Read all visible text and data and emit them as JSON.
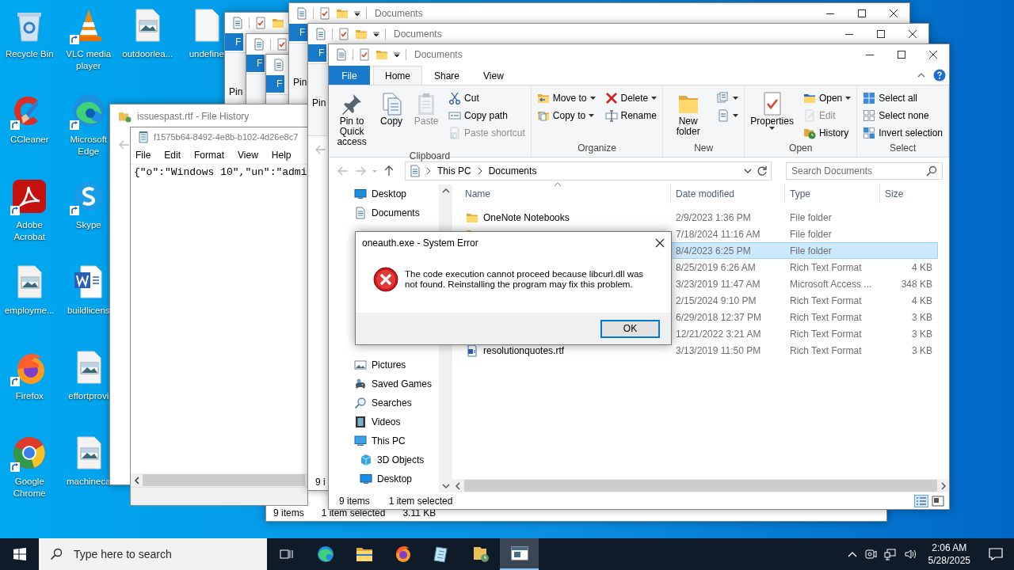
{
  "desktop": {
    "columns": [
      {
        "icons": [
          {
            "label": "Recycle Bin",
            "shortcut": false
          },
          {
            "label": "CCleaner",
            "shortcut": true
          },
          {
            "label": "Adobe Acrobat",
            "shortcut": true
          },
          {
            "label": "employme...",
            "shortcut": false
          },
          {
            "label": "Firefox",
            "shortcut": true
          },
          {
            "label": "Google Chrome",
            "shortcut": true
          }
        ]
      },
      {
        "icons": [
          {
            "label": "VLC media player",
            "shortcut": true
          },
          {
            "label": "Microsoft Edge",
            "shortcut": true
          },
          {
            "label": "Skype",
            "shortcut": true
          },
          {
            "label": "buildlicens",
            "shortcut": false
          },
          {
            "label": "effortprovi",
            "shortcut": false
          },
          {
            "label": "machineca",
            "shortcut": false
          }
        ]
      },
      {
        "icons": [
          {
            "label": "outdoorlea...",
            "shortcut": false
          }
        ]
      },
      {
        "icons": [
          {
            "label": "undefine",
            "shortcut": false
          }
        ]
      }
    ]
  },
  "back_windows": [
    {
      "file_tab": "F",
      "ribbon_text": "Pin"
    },
    {
      "file_tab": "F"
    },
    {
      "file_tab": "F",
      "status": [
        "9 items",
        "1 item selected",
        "3.11 KB"
      ]
    },
    {
      "title": "Documents",
      "file_tab": "F",
      "ribbon_text": "Pin"
    },
    {
      "title": "Documents",
      "file_tab": "F",
      "ribbon_text": "Pin",
      "status": [
        "9 i"
      ]
    }
  ],
  "file_history": {
    "title": "issuespast.rtf - File History",
    "preview": {
      "file_name": "f1575b64-8492-4e8b-b102-4d26e8c7",
      "menu": [
        "File",
        "Edit",
        "Format",
        "View",
        "Help"
      ],
      "content": "{\"o\":\"Windows 10\",\"un\":\"admi"
    }
  },
  "explorer": {
    "title": "Documents",
    "ribbon_tabs": [
      {
        "label": "File",
        "kind": "file",
        "selected": false
      },
      {
        "label": "Home",
        "kind": "tab",
        "selected": true
      },
      {
        "label": "Share",
        "kind": "tab",
        "selected": false
      },
      {
        "label": "View",
        "kind": "tab",
        "selected": false
      }
    ],
    "ribbon": [
      {
        "label": "Clipboard",
        "items": [
          {
            "kind": "large",
            "label": "Pin to Quick access",
            "dropdown": false,
            "disabled": false
          },
          {
            "kind": "large",
            "label": "Copy",
            "dropdown": false,
            "disabled": false
          },
          {
            "kind": "large",
            "label": "Paste",
            "dropdown": false,
            "disabled": true
          },
          {
            "kind": "stack",
            "items": [
              {
                "label": "Cut",
                "dropdown": false,
                "disabled": false
              },
              {
                "label": "Copy path",
                "dropdown": false,
                "disabled": false
              },
              {
                "label": "Paste shortcut",
                "dropdown": false,
                "disabled": true
              }
            ]
          }
        ]
      },
      {
        "label": "Organize",
        "items": [
          {
            "kind": "stack",
            "items": [
              {
                "label": "Move to",
                "dropdown": true,
                "disabled": false
              },
              {
                "label": "Copy to",
                "dropdown": true,
                "disabled": false
              }
            ]
          },
          {
            "kind": "stack",
            "items": [
              {
                "label": "Delete",
                "dropdown": true,
                "disabled": false
              },
              {
                "label": "Rename",
                "dropdown": false,
                "disabled": false
              }
            ]
          }
        ]
      },
      {
        "label": "New",
        "items": [
          {
            "kind": "large",
            "label": "New folder",
            "dropdown": false,
            "disabled": false
          },
          {
            "kind": "stack",
            "items": [
              {
                "dropdown": true,
                "disabled": false
              },
              {
                "dropdown": true,
                "disabled": false
              }
            ]
          }
        ]
      },
      {
        "label": "Open",
        "items": [
          {
            "kind": "large",
            "label": "Properties",
            "dropdown": true,
            "disabled": false
          },
          {
            "kind": "stack",
            "items": [
              {
                "label": "Open",
                "dropdown": true,
                "disabled": false
              },
              {
                "label": "Edit",
                "dropdown": false,
                "disabled": true
              },
              {
                "label": "History",
                "dropdown": false,
                "disabled": false
              }
            ]
          }
        ]
      },
      {
        "label": "Select",
        "items": [
          {
            "kind": "stack",
            "items": [
              {
                "label": "Select all",
                "dropdown": false,
                "disabled": false
              },
              {
                "label": "Select none",
                "dropdown": false,
                "disabled": false
              },
              {
                "label": "Invert selection",
                "dropdown": false,
                "disabled": false
              }
            ]
          }
        ]
      }
    ],
    "path": [
      "This PC",
      "Documents"
    ],
    "search": {
      "placeholder": "Search Documents"
    },
    "nav": [
      {
        "label": "Desktop"
      },
      {
        "label": "Documents"
      },
      {
        "label": "Pictures"
      },
      {
        "label": "Saved Games"
      },
      {
        "label": "Searches"
      },
      {
        "label": "Videos"
      },
      {
        "label": "This PC",
        "children": [
          {
            "label": "3D Objects"
          },
          {
            "label": "Desktop"
          }
        ]
      }
    ],
    "columns": [
      "Name",
      "Date modified",
      "Type",
      "Size"
    ],
    "rows": [
      {
        "name": "OneNote Notebooks",
        "kind": "folder",
        "date": "2/9/2023 1:36 PM",
        "type": "File folder",
        "selected": false
      },
      {
        "kind": "folder",
        "date": "7/18/2024 11:16 AM",
        "type": "File folder",
        "selected": false
      },
      {
        "date": "8/4/2023 6:25 PM",
        "type": "File folder",
        "selected": true
      },
      {
        "date": "8/25/2019 6:26 AM",
        "type": "Rich Text Format",
        "size": "4 KB",
        "selected": false
      },
      {
        "date": "3/23/2019 11:47 AM",
        "type": "Microsoft Access ...",
        "size": "348 KB",
        "selected": false
      },
      {
        "date": "2/15/2024 9:10 PM",
        "type": "Rich Text Format",
        "size": "4 KB",
        "selected": false
      },
      {
        "date": "6/29/2018 12:37 PM",
        "type": "Rich Text Format",
        "size": "3 KB",
        "selected": false
      },
      {
        "date": "12/21/2022 3:21 AM",
        "type": "Rich Text Format",
        "size": "3 KB",
        "selected": false
      },
      {
        "name": "resolutionquotes.rtf",
        "kind": "file",
        "date": "3/13/2019 11:50 PM",
        "type": "Rich Text Format",
        "size": "3 KB",
        "selected": false
      }
    ],
    "status": [
      "9 items",
      "1 item selected"
    ]
  },
  "dialog": {
    "title": "oneauth.exe - System Error",
    "message": "The code execution cannot proceed because libcurl.dll was not found. Reinstalling the program may fix this problem.",
    "button": "OK"
  },
  "taskbar": {
    "search_placeholder": "Type here to search",
    "apps": [
      {
        "selected": false
      },
      {
        "selected": false
      },
      {
        "selected": false
      },
      {
        "selected": false
      },
      {
        "selected": false
      },
      {
        "selected": true
      }
    ],
    "time": "2:06 AM",
    "date": "5/28/2025"
  }
}
